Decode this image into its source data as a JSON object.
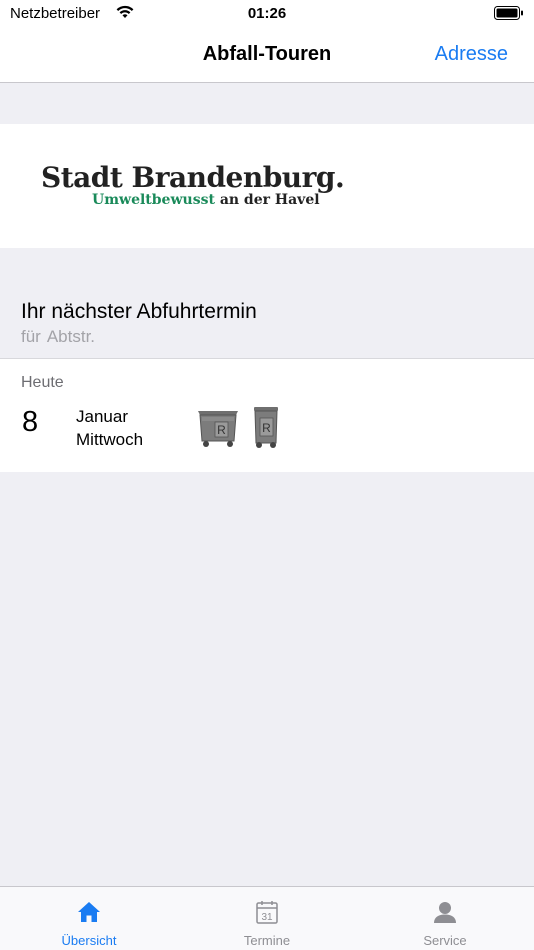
{
  "status_bar": {
    "carrier": "Netzbetreiber",
    "time": "01:26"
  },
  "nav": {
    "title": "Abfall-Touren",
    "right_button": "Adresse"
  },
  "logo": {
    "main": "Stadt Brandenburg.",
    "sub_green": "Umweltbewusst",
    "sub_dark": "an der Havel"
  },
  "next_pickup": {
    "title": "Ihr nächster Abfuhrtermin",
    "for_label": "für",
    "street": "Abtstr."
  },
  "pickup": {
    "relative_day": "Heute",
    "day": "8",
    "month": "Januar",
    "weekday": "Mittwoch",
    "bins": [
      "container-bin-r-icon",
      "wheelie-bin-r-icon"
    ],
    "bin_letter": "R"
  },
  "tabs": [
    {
      "label": "Übersicht",
      "icon": "home-icon",
      "active": true
    },
    {
      "label": "Termine",
      "icon": "calendar-icon",
      "active": false,
      "icon_text": "31"
    },
    {
      "label": "Service",
      "icon": "person-icon",
      "active": false
    }
  ],
  "colors": {
    "accent": "#1a7cf2",
    "logo_green": "#1a8a5a",
    "background": "#efeff4"
  }
}
